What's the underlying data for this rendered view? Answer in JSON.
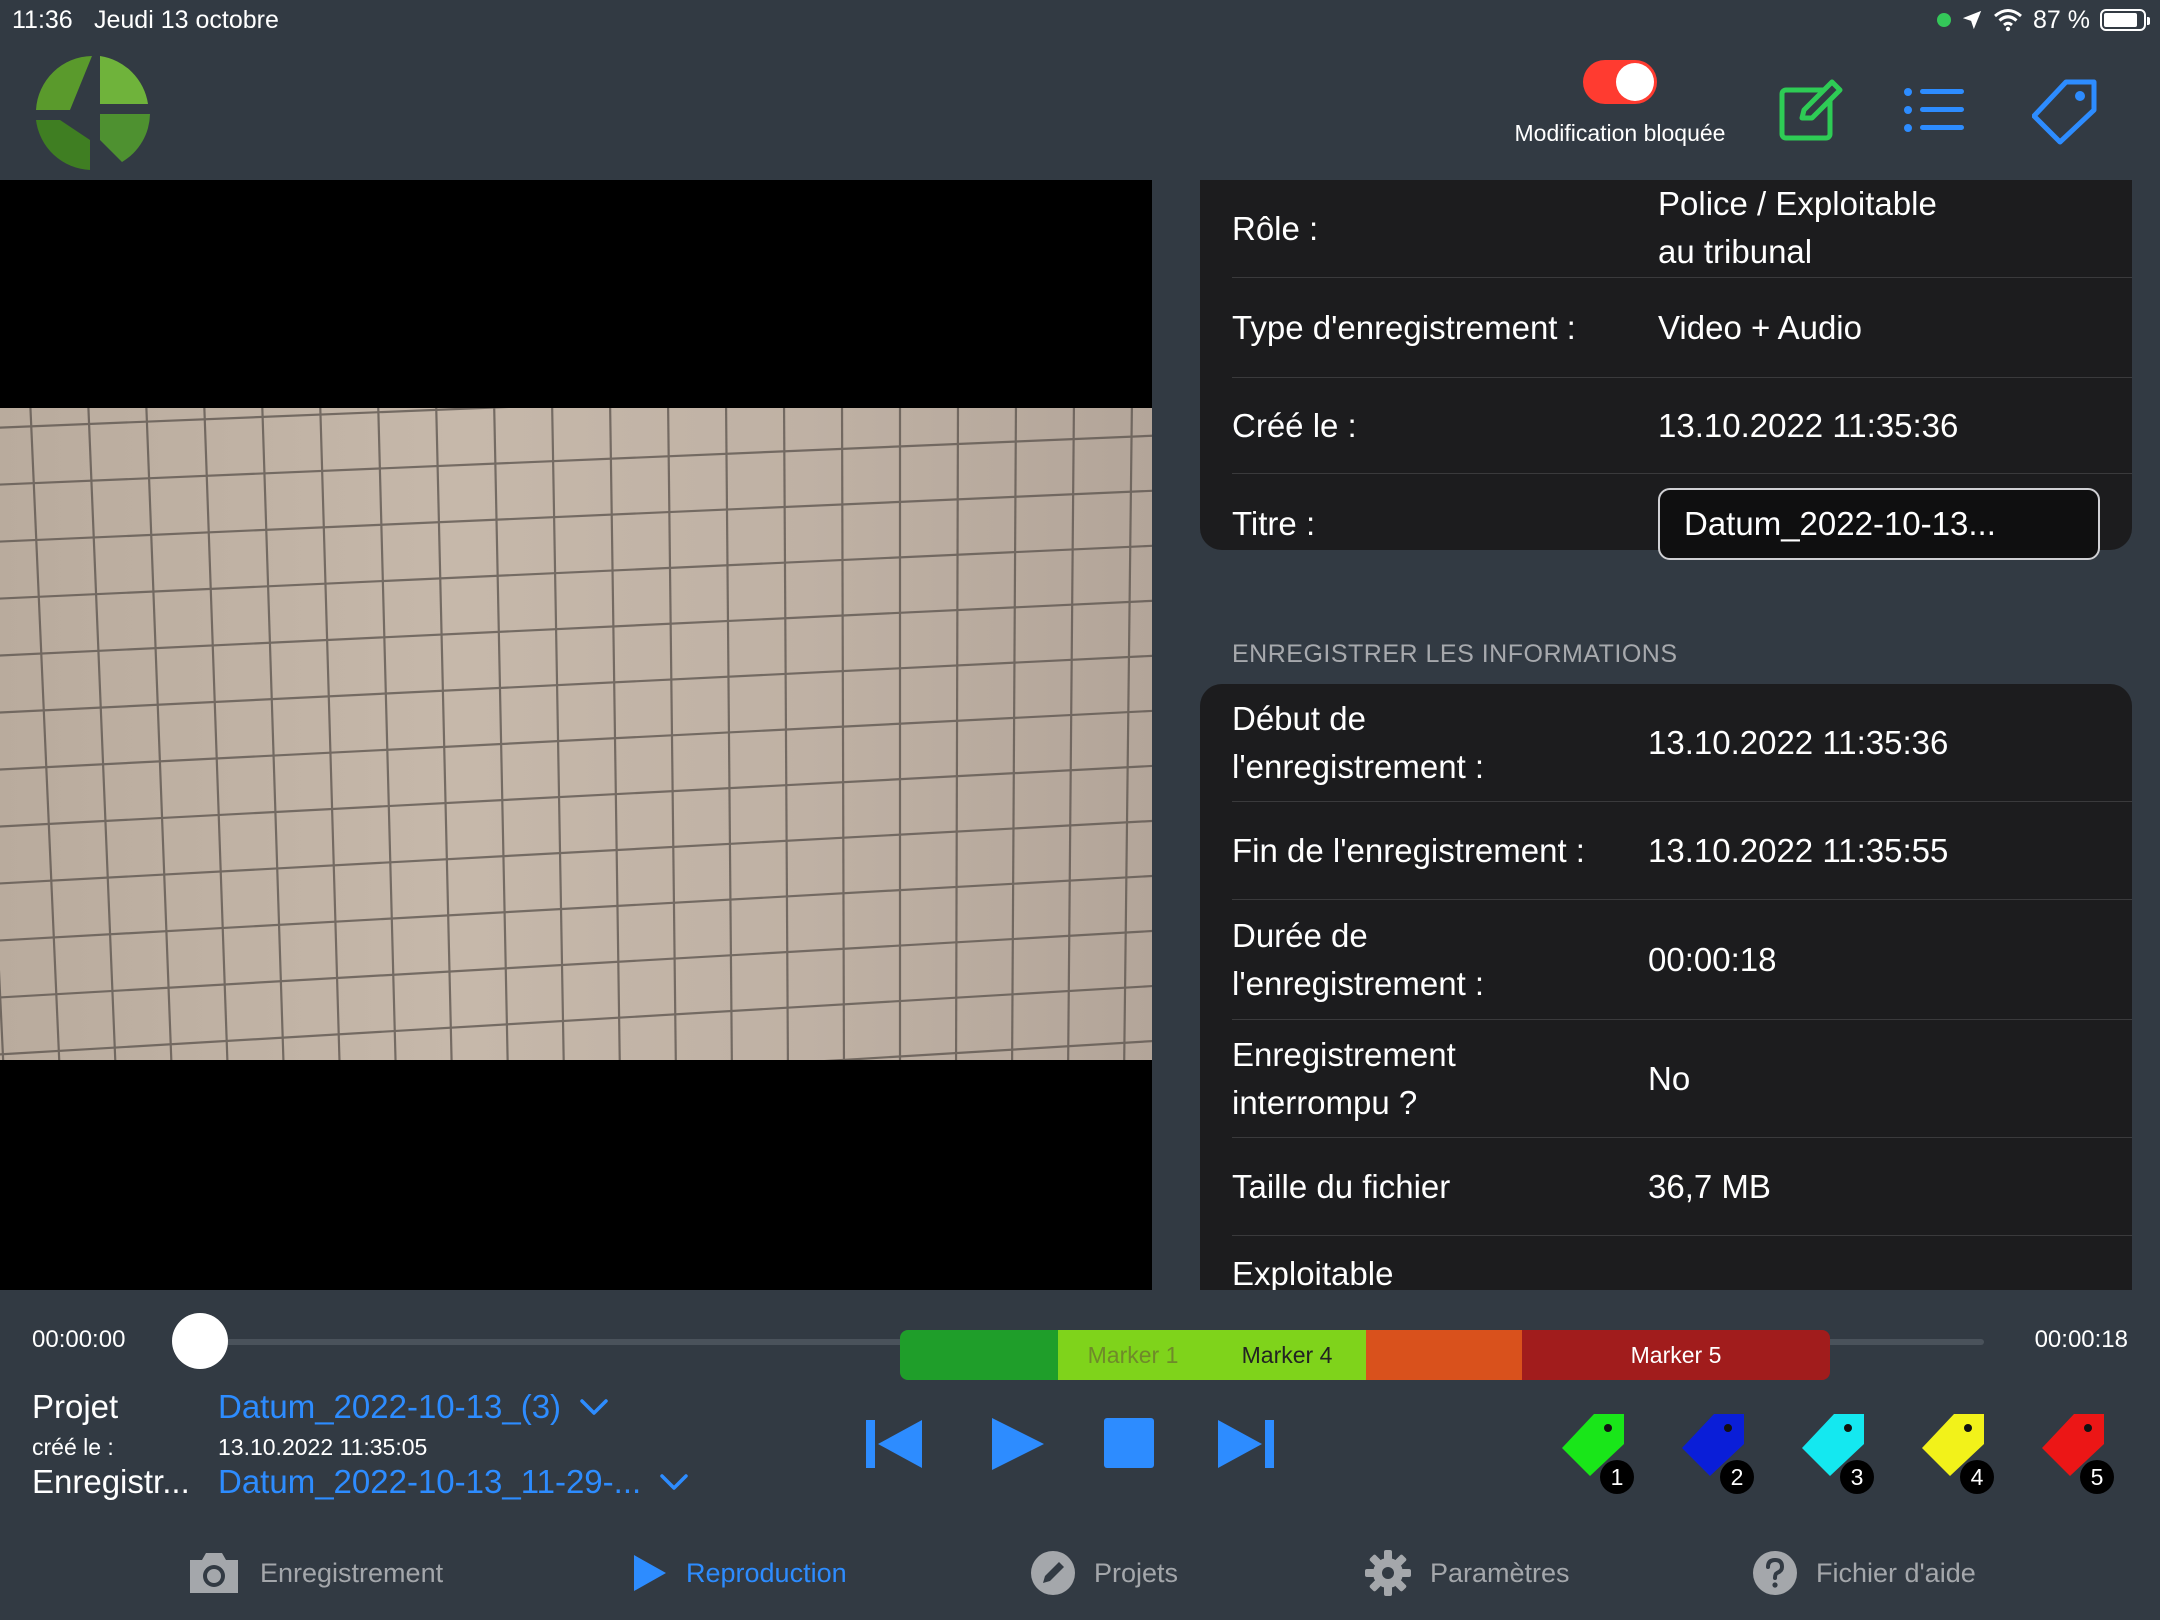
{
  "status_bar": {
    "time": "11:36",
    "date": "Jeudi 13 octobre",
    "battery": "87 %",
    "battery_level": 0.87
  },
  "header": {
    "toggle_label": "Modification bloquée",
    "toggle_on": true,
    "icons": [
      "edit-icon",
      "list-icon",
      "tag-icon"
    ]
  },
  "details": {
    "role_label": "Rôle :",
    "role_value_line1": "Police / Exploitable",
    "role_value_line2": "au tribunal",
    "type_label": "Type d'enregistrement :",
    "type_value": "Video + Audio",
    "created_label": "Créé le :",
    "created_value": "13.10.2022 11:35:36",
    "title_label": "Titre :",
    "title_value": "Datum_2022-10-13..."
  },
  "record_info": {
    "section_title": "ENREGISTRER LES INFORMATIONS",
    "start_label_line1": "Début de",
    "start_label_line2": "l'enregistrement :",
    "start_value": "13.10.2022 11:35:36",
    "end_label": "Fin de l'enregistrement :",
    "end_value": "13.10.2022 11:35:55",
    "duration_label_line1": "Durée de",
    "duration_label_line2": "l'enregistrement :",
    "duration_value": "00:00:18",
    "interrupted_label_line1": "Enregistrement",
    "interrupted_label_line2": "interrompu ?",
    "interrupted_value": "No",
    "filesize_label": "Taille du fichier",
    "filesize_value": "36,7 MB",
    "exploitable_label": "Exploitable"
  },
  "playback": {
    "time_start": "00:00:00",
    "time_end": "00:00:18",
    "markers": [
      {
        "label": "",
        "color": "#1f9e2a"
      },
      {
        "label": "Marker 1",
        "color": "#7fd31b"
      },
      {
        "label": "Marker 4",
        "color": "#7fd31b"
      },
      {
        "label": "",
        "color": "#d9511c"
      },
      {
        "label": "Marker 5",
        "color": "#a11c1c"
      }
    ],
    "project_label": "Projet",
    "project_value": "Datum_2022-10-13_(3)",
    "created_label": "créé le :",
    "created_value": "13.10.2022 11:35:05",
    "recording_label": "Enregistr...",
    "recording_value": "Datum_2022-10-13_11-29-...",
    "tags": [
      {
        "num": "1",
        "color": "#19e619"
      },
      {
        "num": "2",
        "color": "#0a1ed8"
      },
      {
        "num": "3",
        "color": "#14e8f0"
      },
      {
        "num": "4",
        "color": "#f2f21a"
      },
      {
        "num": "5",
        "color": "#ec1616"
      }
    ]
  },
  "tabs": [
    {
      "label": "Enregistrement",
      "icon": "camera-icon",
      "active": false
    },
    {
      "label": "Reproduction",
      "icon": "play-icon",
      "active": true
    },
    {
      "label": "Projets",
      "icon": "pencil-icon",
      "active": false
    },
    {
      "label": "Paramètres",
      "icon": "gear-icon",
      "active": false
    },
    {
      "label": "Fichier d'aide",
      "icon": "help-icon",
      "active": false
    }
  ]
}
